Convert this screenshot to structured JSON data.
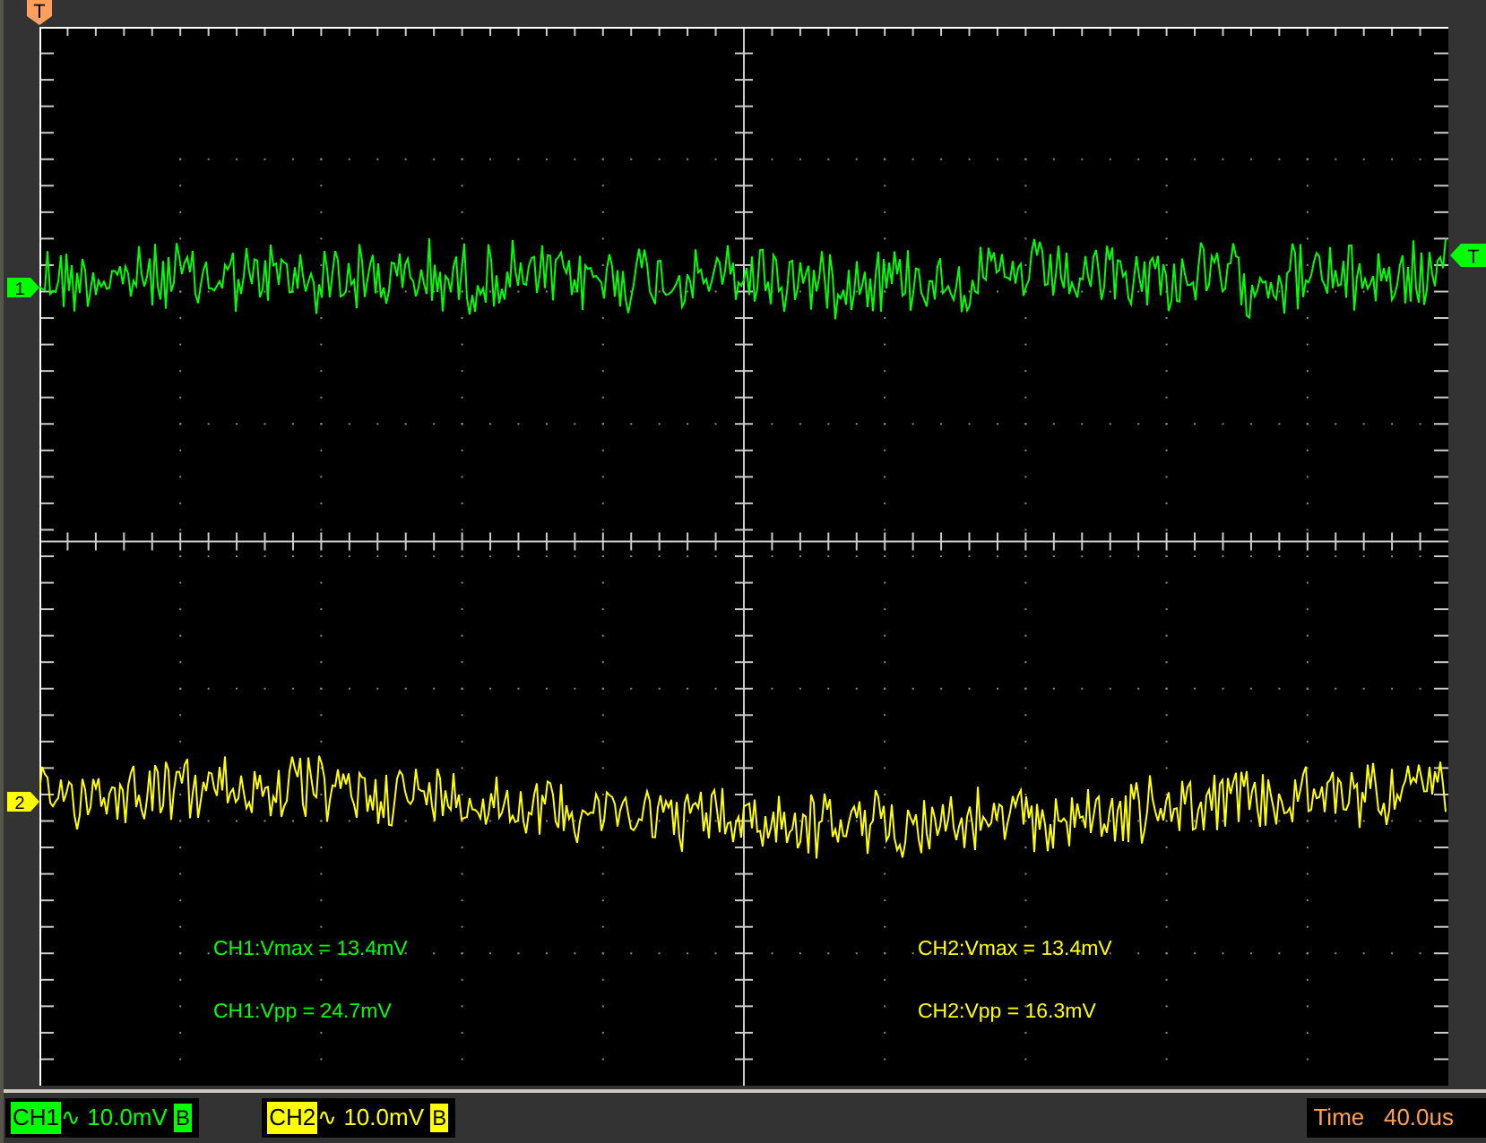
{
  "trigger_position_marker": {
    "label": "T"
  },
  "trigger_level_marker": {
    "label": "T"
  },
  "channels": [
    {
      "marker": "1",
      "color": "#00ff00",
      "measurements": [
        "CH1:Vmax = 13.4mV",
        "CH1:Vpp = 24.7mV"
      ],
      "status": {
        "name": "CH1",
        "coupling": "∿",
        "scale": "10.0mV",
        "bandwidth": "B"
      }
    },
    {
      "marker": "2",
      "color": "#ffff00",
      "measurements": [
        "CH2:Vmax = 13.4mV",
        "CH2:Vpp = 16.3mV"
      ],
      "status": {
        "name": "CH2",
        "coupling": "∿",
        "scale": "10.0mV",
        "bandwidth": "B"
      }
    }
  ],
  "timebase": {
    "label": "Time",
    "value": "40.0us"
  }
}
